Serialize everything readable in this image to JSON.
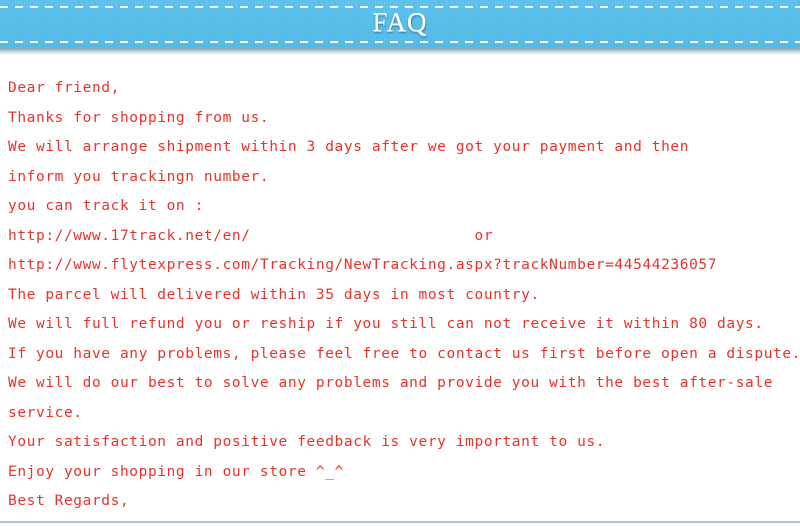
{
  "banner": {
    "title": "FAQ",
    "background_color": "#57bde9",
    "title_color": "#ffffff",
    "dash_color": "#ffffff"
  },
  "body": {
    "text_color": "#e8332a",
    "lines": [
      "Dear friend,",
      "Thanks for shopping from us.",
      "We will arrange shipment within 3 days after we got your payment and then",
      "inform you trackingn number.",
      "you can track it on :",
      "http://www.17track.net/en/                        or",
      "http://www.flytexpress.com/Tracking/NewTracking.aspx?trackNumber=44544236057",
      "The parcel will delivered within 35 days in most country.",
      "We will full refund you or reship if you still can not receive it within 80 days.",
      "If you have any problems, please feel free to contact us first before open a dispute.",
      "We will do our best to solve any problems and provide you with the best after-sale",
      "service.",
      "Your satisfaction and positive feedback is very important to us.",
      "Enjoy your shopping in our store ^_^",
      "Best Regards,"
    ]
  },
  "footer": {
    "rule_color": "#9cbccb"
  }
}
